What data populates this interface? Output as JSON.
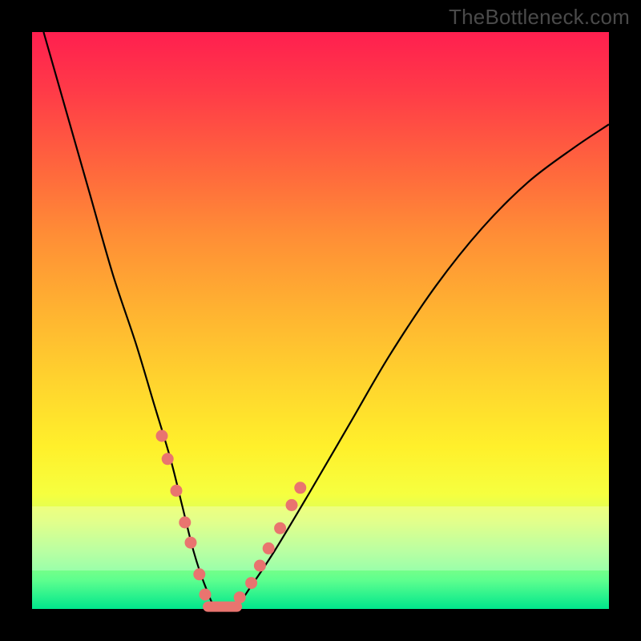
{
  "watermark": "TheBottleneck.com",
  "chart_data": {
    "type": "line",
    "title": "",
    "xlabel": "",
    "ylabel": "",
    "xlim": [
      0,
      100
    ],
    "ylim": [
      0,
      100
    ],
    "grid": false,
    "legend": false,
    "series": [
      {
        "name": "bottleneck-curve",
        "x": [
          2,
          6,
          10,
          14,
          18,
          21,
          24,
          26,
          28,
          30,
          32,
          35,
          38,
          42,
          48,
          55,
          62,
          70,
          78,
          86,
          94,
          100
        ],
        "y": [
          100,
          86,
          72,
          58,
          46,
          36,
          26,
          18,
          10,
          4,
          0,
          0,
          4,
          10,
          20,
          32,
          44,
          56,
          66,
          74,
          80,
          84
        ]
      }
    ],
    "beads_left": [
      {
        "x": 22.5,
        "y": 30
      },
      {
        "x": 23.5,
        "y": 26
      },
      {
        "x": 25.0,
        "y": 20.5
      },
      {
        "x": 26.5,
        "y": 15
      },
      {
        "x": 27.5,
        "y": 11.5
      },
      {
        "x": 29.0,
        "y": 6
      },
      {
        "x": 30.0,
        "y": 2.5
      }
    ],
    "beads_right": [
      {
        "x": 36.0,
        "y": 2.0
      },
      {
        "x": 38.0,
        "y": 4.5
      },
      {
        "x": 39.5,
        "y": 7.5
      },
      {
        "x": 41.0,
        "y": 10.5
      },
      {
        "x": 43.0,
        "y": 14
      },
      {
        "x": 45.0,
        "y": 18
      },
      {
        "x": 46.5,
        "y": 21
      }
    ],
    "flat_segment": {
      "x1": 30.5,
      "x2": 35.5,
      "y": 0.4
    },
    "colors": {
      "curve": "#000000",
      "bead": "#e9746f",
      "gradient_top": "#ff1f4f",
      "gradient_bottom": "#00e68c"
    }
  }
}
